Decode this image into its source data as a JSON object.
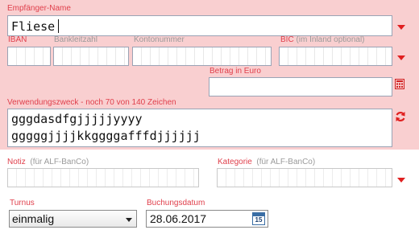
{
  "recipient": {
    "label": "Empfänger-Name",
    "value": "Fliese"
  },
  "iban": {
    "label": "IBAN",
    "value": ""
  },
  "bankleitzahl": {
    "label": "Bankleitzahl",
    "value": ""
  },
  "kontonummer": {
    "label": "Kontonummer",
    "value": ""
  },
  "bic": {
    "label": "BIC",
    "hint": "(im Inland optional)",
    "value": ""
  },
  "amount": {
    "label": "Betrag in Euro",
    "value": ""
  },
  "purpose": {
    "label": "Verwendungszweck - noch 70 von 140 Zeichen",
    "line1": "gggdasdfgjjjjjyyyy",
    "line2": "gggggjjjjkkggggafffdjjjjjj"
  },
  "notiz": {
    "label": "Notiz",
    "hint": "(für ALF-BanCo)",
    "value": ""
  },
  "kategorie": {
    "label": "Kategorie",
    "hint": "(für ALF-BanCo)",
    "value": ""
  },
  "turnus": {
    "label": "Turnus",
    "value": "einmalig"
  },
  "buchungsdatum": {
    "label": "Buchungsdatum",
    "value": "28.06.2017",
    "calendar_day": "15"
  },
  "colors": {
    "panel": "#f9cfd0",
    "label": "#e0404c",
    "accent": "#e02020"
  }
}
